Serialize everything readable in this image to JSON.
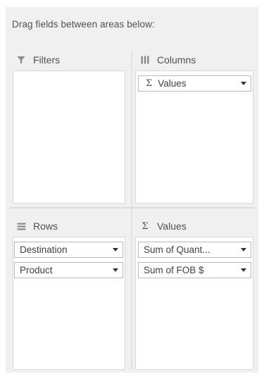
{
  "instruction": "Drag fields between areas below:",
  "areas": {
    "filters": {
      "label": "Filters",
      "icon": "filter-icon",
      "fields": []
    },
    "columns": {
      "label": "Columns",
      "icon": "columns-icon",
      "fields": [
        {
          "label": "Values",
          "icon": "sigma-icon"
        }
      ]
    },
    "rows": {
      "label": "Rows",
      "icon": "rows-icon",
      "fields": [
        {
          "label": "Destination"
        },
        {
          "label": "Product"
        }
      ]
    },
    "values": {
      "label": "Values",
      "icon": "sigma-icon",
      "fields": [
        {
          "label": "Sum of Quant..."
        },
        {
          "label": "Sum of FOB $"
        }
      ]
    }
  },
  "sigma_glyph": "Σ",
  "colors": {
    "panel_background": "#f0f0f0",
    "area_background": "#ffffff",
    "text": "#505050",
    "chip_border": "#b9b9b9"
  }
}
